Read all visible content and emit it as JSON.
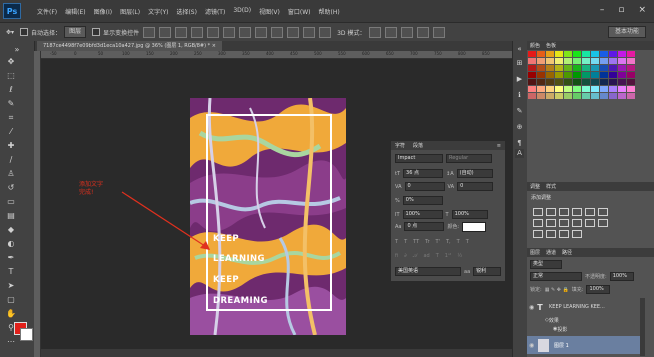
{
  "app": {
    "logo": "Ps"
  },
  "menubar": {
    "items": [
      "文件(F)",
      "编辑(E)",
      "图像(I)",
      "图层(L)",
      "文字(Y)",
      "选择(S)",
      "滤镜(T)",
      "3D(D)",
      "视图(V)",
      "窗口(W)",
      "帮助(H)"
    ]
  },
  "window_controls": {
    "minimize": "–",
    "restore": "▫",
    "close": "×"
  },
  "options_bar": {
    "auto_select_label": "自动选择：",
    "auto_select_value": "图层",
    "transform_label": "显示变换控件",
    "mode_3d": "3D 模式：",
    "workspace": "基本功能"
  },
  "document": {
    "tab_title": "7187ce4498f7e09bfd3d1eca10a427.jpg @ 36% (图层 1, RGB/8#) *  ×"
  },
  "rulers": {
    "h_ticks": [
      "-50",
      "0",
      "50",
      "100",
      "150",
      "200",
      "250",
      "300",
      "350",
      "400",
      "450",
      "500",
      "550",
      "600",
      "650",
      "700",
      "750",
      "800",
      "850"
    ]
  },
  "artwork": {
    "lines": [
      "KEEP",
      "LEARNING",
      "KEEP",
      "DREAMING"
    ]
  },
  "annotation": {
    "line1": "添加文字",
    "line2": "完成!"
  },
  "character_panel": {
    "tabs": [
      "字符",
      "段落"
    ],
    "font_family": "Impact",
    "font_style": "Regular",
    "font_size": "36 点",
    "leading": "(自动)",
    "kerning": "0",
    "tracking": "0",
    "scale_pct": "0%",
    "vscale": "100%",
    "hscale": "100%",
    "baseline": "0 点",
    "color_label": "颜色:",
    "type_buttons": [
      "T",
      "T",
      "TT",
      "Tr",
      "T'",
      "T,",
      "T",
      "T"
    ],
    "language": "美国英语",
    "aa_label": "aa",
    "aa_value": "锐利"
  },
  "swatches_panel": {
    "tabs": [
      "颜色",
      "色板"
    ]
  },
  "adjustments_panel": {
    "tabs": [
      "调整",
      "样式"
    ],
    "title": "添加调整"
  },
  "layers_panel": {
    "tabs": [
      "图层",
      "通道",
      "路径"
    ],
    "filter": "类型",
    "blend_mode": "正常",
    "opacity_label": "不透明度:",
    "opacity_value": "100%",
    "lock_label": "锁定:",
    "fill_label": "填充:",
    "fill_value": "100%",
    "layers": [
      {
        "name": "KEEP LEARNING KEE...",
        "type": "text"
      },
      {
        "name": "效果",
        "type": "effect"
      },
      {
        "name": "投影",
        "type": "effect"
      },
      {
        "name": "图层 1",
        "type": "image"
      }
    ]
  },
  "colors": {
    "foreground": "#e0201a",
    "background": "#ffffff",
    "annotation_red": "#e0301e"
  }
}
